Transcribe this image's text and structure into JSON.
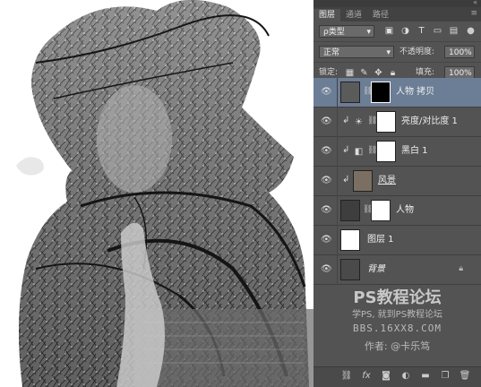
{
  "panel": {
    "tabs": [
      {
        "label": "图层"
      },
      {
        "label": "通道"
      },
      {
        "label": "路径"
      }
    ],
    "filter": {
      "kind": "ρ类型"
    },
    "blend": {
      "mode": "正常",
      "opacity_label": "不透明度:",
      "opacity": "100%"
    },
    "lock": {
      "label": "锁定:",
      "fill_label": "填充:",
      "fill": "100%"
    },
    "layers": [
      {
        "name": "人物 拷贝"
      },
      {
        "name": "亮度/对比度 1"
      },
      {
        "name": "黑白 1"
      },
      {
        "name": "风景"
      },
      {
        "name": "人物"
      },
      {
        "name": "图层 1"
      },
      {
        "name": "背景"
      }
    ],
    "watermark": {
      "title": "PS教程论坛",
      "line2": "学PS, 就到PS教程论坛",
      "line3": "BBS.16XX8.COM",
      "line4": "作者: @卡乐笃"
    }
  },
  "colors": {
    "panel_bg": "#535353",
    "selected_layer": "#6c7d96",
    "canvas_bg": "#ffffff"
  },
  "icons": [
    "eye-icon",
    "chain-icon",
    "lock-icon",
    "link-layers-icon",
    "fx-icon",
    "mask-icon",
    "adjustment-icon",
    "folder-icon",
    "new-layer-icon",
    "trash-icon"
  ]
}
